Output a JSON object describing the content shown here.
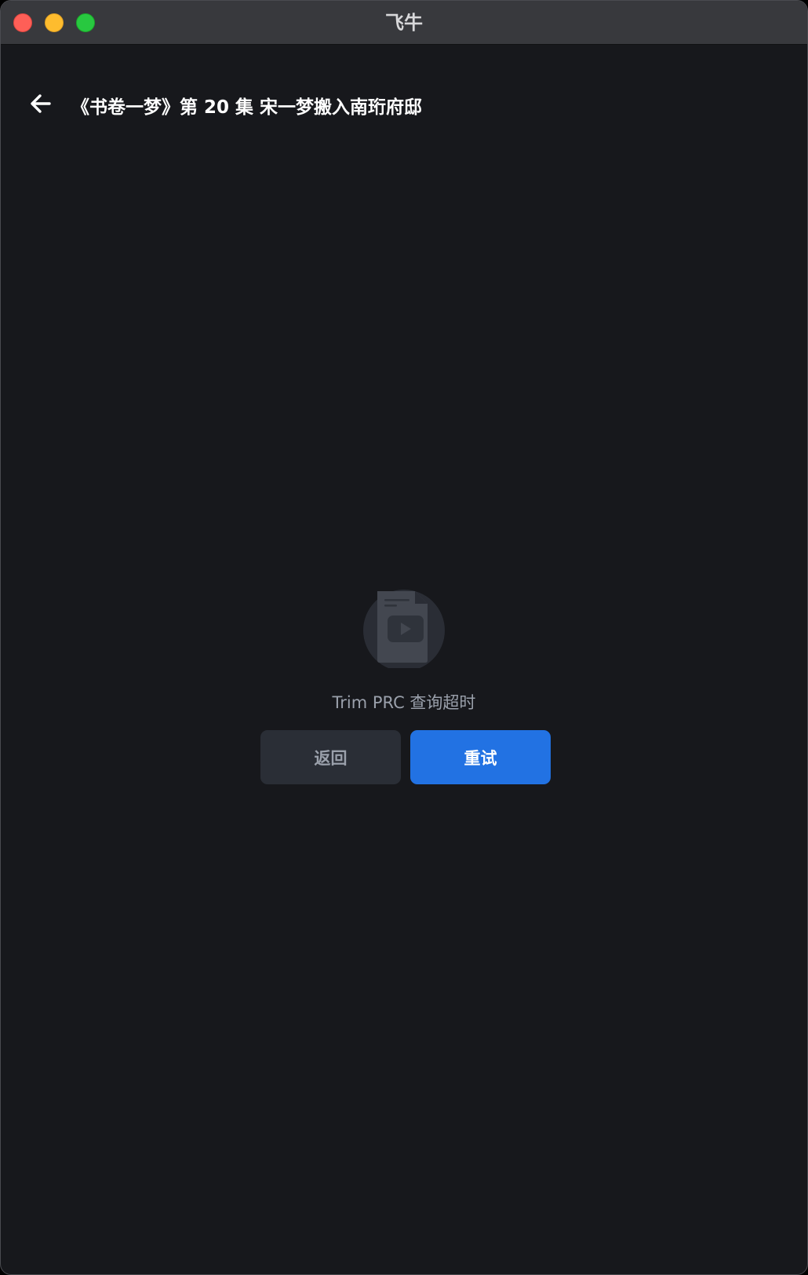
{
  "window": {
    "title": "飞牛"
  },
  "header": {
    "back_icon": "arrow-left-icon",
    "title": "《书卷一梦》第 20 集 宋一梦搬入南珩府邸"
  },
  "empty_state": {
    "icon": "video-file-icon",
    "message": "Trim PRC 查询超时",
    "back_label": "返回",
    "retry_label": "重试"
  },
  "colors": {
    "background": "#17181c",
    "titlebar": "#38393d",
    "retry_button": "#2272e3",
    "back_button": "#2a2e36"
  }
}
